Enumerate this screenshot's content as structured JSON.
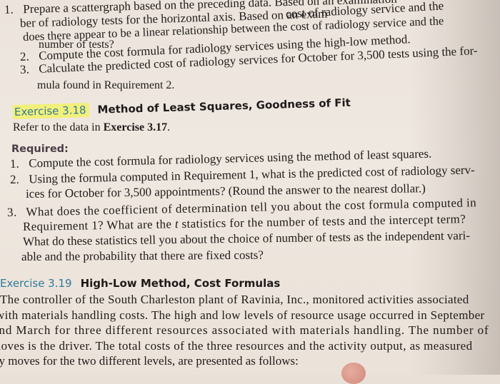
{
  "prev_exercise": {
    "items": [
      {
        "number": "1.",
        "lines": [
          "Prepare a scattergraph based on the preceding data. Based on an examination of the graph,",
          "ber of radiology tests for the horizontal axis. Based on an examination of the cost of radiology service and the",
          "does there appear to be a linear relationship between the cost of radiology service and the",
          "number of tests?"
        ]
      },
      {
        "number": "2.",
        "lines": [
          "Compute the cost formula for radiology services using the high-low method."
        ]
      },
      {
        "number": "3.",
        "lines": [
          "Calculate the predicted cost of radiology services for October for 3,500 tests using the for-",
          "mula found in Requirement 2."
        ]
      }
    ],
    "visible_lines": {
      "l1": "Prepare a scattergraph based on the preceding data. Based on an examination",
      "l2": "ber of radiology tests for the horizontal axis. Based on an exam",
      "l2b": "cost of radiology service and the",
      "l3": "does there appear to be a linear relationship between the cost of radiology service and the",
      "l4": "number of tests?",
      "i2": "Compute the cost formula for radiology services using the high-low method.",
      "i3a": "Calculate the predicted cost of radiology services for October for 3,500 tests using the for-",
      "i3b": "mula found in Requirement 2."
    }
  },
  "exercise_318": {
    "number": "Exercise 3.18",
    "title": "Method of Least Squares, Goodness of Fit",
    "intro_prefix": "Refer to the data in ",
    "intro_ref": "Exercise 3.17",
    "intro_suffix": ".",
    "required_label": "Required:",
    "items": [
      {
        "number": "1.",
        "lines": [
          "Compute the cost formula for radiology services using the method of least squares."
        ]
      },
      {
        "number": "2.",
        "lines": [
          "Using the formula computed in Requirement 1, what is the predicted cost of radiology serv-",
          "ices for October for 3,500 appointments? (Round the answer to the nearest dollar.)"
        ]
      },
      {
        "number": "3.",
        "lines": [
          "What does the coefficient of determination tell you about the cost formula computed in",
          "Requirement 1? What are the ",
          "t",
          " statistics for the number of tests and the intercept term?",
          "What do these statistics tell you about the choice of number of tests as the independent vari-",
          "able and the probability that there are fixed costs?"
        ]
      }
    ]
  },
  "exercise_319": {
    "number": "Exercise 3.19",
    "title": "High-Low Method, Cost Formulas",
    "lines": [
      "The controller of the South Charleston plant of Ravinia, Inc., monitored activities associated",
      "with materials handling costs. The high and low levels of resource usage occurred in September",
      "and March for three different resources associated with materials handling. The number of",
      "moves is the driver. The total costs of the three resources and the activity output, as measured",
      "by moves for the two different levels, are presented as follows:"
    ]
  },
  "colors": {
    "exercise_number": "#2e7a9a",
    "highlight": "#f2f07a",
    "required_label": "#4b3d47",
    "paper": "#ece4dc",
    "ink": "#1f1b1a"
  }
}
